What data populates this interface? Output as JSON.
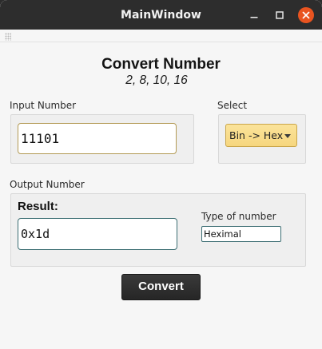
{
  "window": {
    "title": "MainWindow"
  },
  "heading": {
    "title": "Convert Number",
    "subtitle": "2, 8, 10, 16"
  },
  "input_section": {
    "label": "Input Number",
    "value": "11101"
  },
  "select_section": {
    "label": "Select",
    "selected": "Bin -> Hex"
  },
  "output_section": {
    "label": "Output Number",
    "result_label": "Result:",
    "result_value": "0x1d",
    "type_label": "Type of number",
    "type_value": "Heximal"
  },
  "actions": {
    "convert_label": "Convert"
  },
  "icons": {
    "minimize": "minimize-icon",
    "maximize": "maximize-icon",
    "close": "close-icon",
    "dropdown": "chevron-down-icon",
    "toolbar_grip": "grip-icon"
  },
  "colors": {
    "close_button": "#e95420",
    "select_background": "#f6d67e",
    "input_border": "#b39a55",
    "output_border": "#3c6e73",
    "convert_button": "#2d2d2d"
  }
}
